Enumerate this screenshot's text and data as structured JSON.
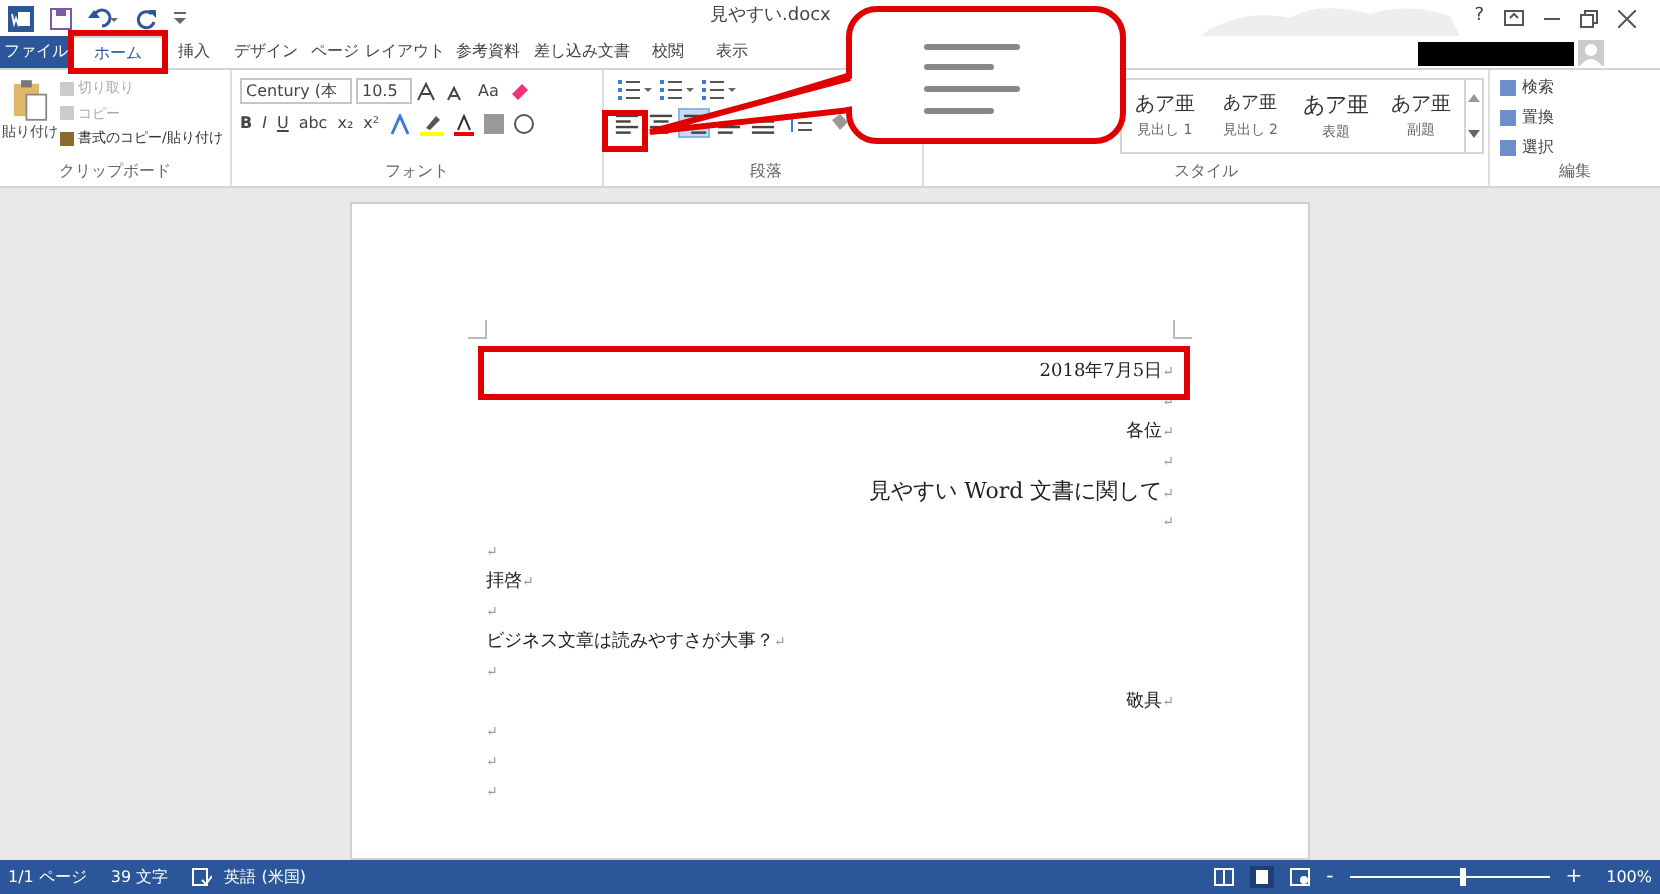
{
  "window": {
    "title": "見やすい.docx",
    "help": "?"
  },
  "tabs": [
    {
      "label": "ファイル",
      "kind": "file",
      "selected": false
    },
    {
      "label": "ホーム",
      "kind": "tab",
      "selected": true
    },
    {
      "label": "挿入",
      "kind": "tab",
      "selected": false
    },
    {
      "label": "デザイン",
      "kind": "tab",
      "selected": false
    },
    {
      "label": "ページ レイアウト",
      "kind": "tab",
      "selected": false
    },
    {
      "label": "参考資料",
      "kind": "tab",
      "selected": false
    },
    {
      "label": "差し込み文書",
      "kind": "tab",
      "selected": false
    },
    {
      "label": "校閲",
      "kind": "tab",
      "selected": false
    },
    {
      "label": "表示",
      "kind": "tab",
      "selected": false
    }
  ],
  "clipboard": {
    "paste": "貼り付け",
    "items": [
      {
        "label": "切り取り",
        "disabled": true
      },
      {
        "label": "コピー",
        "disabled": true
      },
      {
        "label": "書式のコピー/貼り付け",
        "disabled": false
      }
    ],
    "group": "クリップボード"
  },
  "font": {
    "name": "Century (本",
    "size": "10.5",
    "case": "Aa",
    "format": [
      "B",
      "I",
      "U",
      "abc",
      "x₂",
      "x²"
    ],
    "group": "フォント"
  },
  "paragraph": {
    "align": [
      {
        "kind": "left",
        "selected": false
      },
      {
        "kind": "center",
        "selected": false
      },
      {
        "kind": "right",
        "selected": true
      },
      {
        "kind": "justify",
        "selected": false
      },
      {
        "kind": "distributed",
        "selected": false
      }
    ],
    "group": "段落"
  },
  "styles": {
    "items": [
      {
        "sample": "あア亜",
        "label": "見出し 1"
      },
      {
        "sample": "あア亜",
        "label": "見出し 2"
      },
      {
        "sample": "あア亜",
        "label": "表題"
      },
      {
        "sample": "あア亜",
        "label": "副題"
      }
    ],
    "group": "スタイル"
  },
  "editing": {
    "items": [
      "検索",
      "置換",
      "選択"
    ],
    "group": "編集"
  },
  "document": {
    "paragraphs": [
      {
        "text": "2018年7月5日",
        "align_right": true,
        "pilcrow": "↵"
      },
      {
        "align_right": true,
        "pilcrow": "↵"
      },
      {
        "text": "各位",
        "align_right": true,
        "pilcrow": "↵"
      },
      {
        "align_right": true,
        "pilcrow": "↵"
      },
      {
        "text": "見やすい Word 文書に関して",
        "align_right": true,
        "kind": "title",
        "pilcrow": "↵"
      },
      {
        "align_right": true,
        "pilcrow": "↵"
      },
      {
        "align_right": false,
        "pilcrow": "↵"
      },
      {
        "text": "拝啓",
        "align_right": false,
        "pilcrow": "↵"
      },
      {
        "align_right": false,
        "pilcrow": "↵"
      },
      {
        "text": "ビジネス文章は読みやすさが大事？",
        "align_right": false,
        "pilcrow": "↵"
      },
      {
        "align_right": false,
        "pilcrow": "↵"
      },
      {
        "text": "敬具",
        "align_right": true,
        "pilcrow": "↵"
      },
      {
        "align_right": false,
        "pilcrow": "↵"
      },
      {
        "align_right": false,
        "pilcrow": "↵"
      },
      {
        "align_right": false,
        "pilcrow": "↵"
      }
    ]
  },
  "status_bar": {
    "page": "1/1 ページ",
    "words": "39 文字",
    "language": "英語 (米国)",
    "zoom": {
      "minus": "-",
      "plus": "+",
      "level": 0.55,
      "value": "100%"
    }
  }
}
